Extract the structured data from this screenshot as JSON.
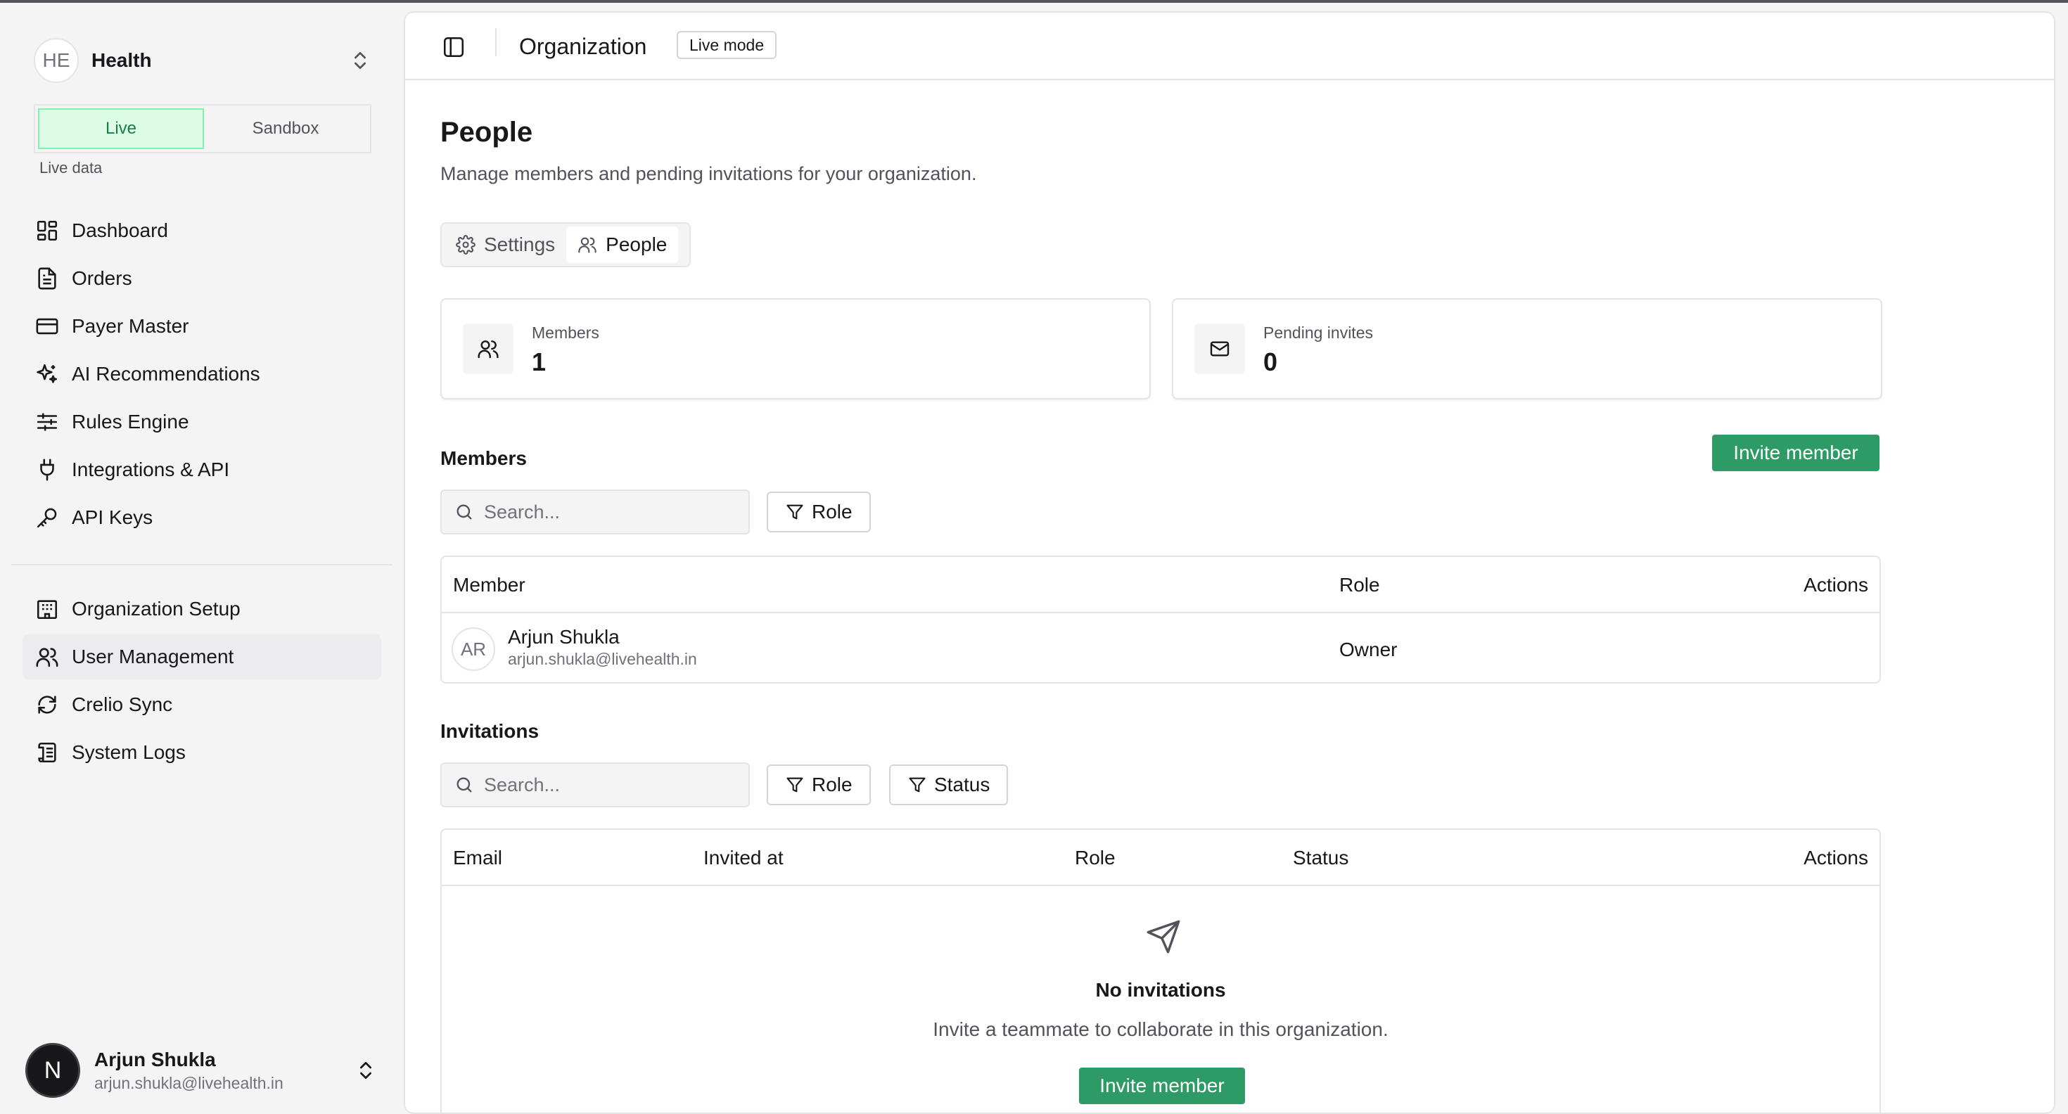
{
  "org": {
    "initials": "HE",
    "name": "Health"
  },
  "mode": {
    "live": "Live",
    "sandbox": "Sandbox",
    "caption": "Live data"
  },
  "nav": [
    {
      "label": "Dashboard",
      "icon": "dashboard-icon"
    },
    {
      "label": "Orders",
      "icon": "file-icon"
    },
    {
      "label": "Payer Master",
      "icon": "credit-card-icon"
    },
    {
      "label": "AI Recommendations",
      "icon": "sparkles-icon"
    },
    {
      "label": "Rules Engine",
      "icon": "sliders-icon"
    },
    {
      "label": "Integrations & API",
      "icon": "plug-icon"
    },
    {
      "label": "API Keys",
      "icon": "key-icon"
    }
  ],
  "nav2": [
    {
      "label": "Organization Setup",
      "icon": "building-icon"
    },
    {
      "label": "User Management",
      "icon": "users-icon",
      "active": true
    },
    {
      "label": "Crelio Sync",
      "icon": "refresh-icon"
    },
    {
      "label": "System Logs",
      "icon": "scroll-icon"
    }
  ],
  "user": {
    "initial": "N",
    "name": "Arjun Shukla",
    "email": "arjun.shukla@livehealth.in"
  },
  "topbar": {
    "breadcrumb": "Organization",
    "badge": "Live mode"
  },
  "page": {
    "title": "People",
    "description": "Manage members and pending invitations for your organization."
  },
  "tabs": [
    {
      "label": "Settings"
    },
    {
      "label": "People",
      "active": true
    }
  ],
  "stats": {
    "members": {
      "label": "Members",
      "value": "1"
    },
    "pending": {
      "label": "Pending invites",
      "value": "0"
    }
  },
  "members": {
    "title": "Members",
    "invite_label": "Invite member",
    "search_placeholder": "Search...",
    "filter_role": "Role",
    "columns": {
      "member": "Member",
      "role": "Role",
      "actions": "Actions"
    },
    "rows": [
      {
        "initials": "AR",
        "name": "Arjun Shukla",
        "email": "arjun.shukla@livehealth.in",
        "role": "Owner"
      }
    ]
  },
  "invitations": {
    "title": "Invitations",
    "search_placeholder": "Search...",
    "filter_role": "Role",
    "filter_status": "Status",
    "columns": {
      "email": "Email",
      "invited_at": "Invited at",
      "role": "Role",
      "status": "Status",
      "actions": "Actions"
    },
    "empty_title": "No invitations",
    "empty_desc": "Invite a teammate to collaborate in this organization.",
    "invite_label": "Invite member"
  },
  "colors": {
    "accent": "#2e9a66",
    "live_bg": "#dcfce7",
    "live_text": "#15803d"
  }
}
